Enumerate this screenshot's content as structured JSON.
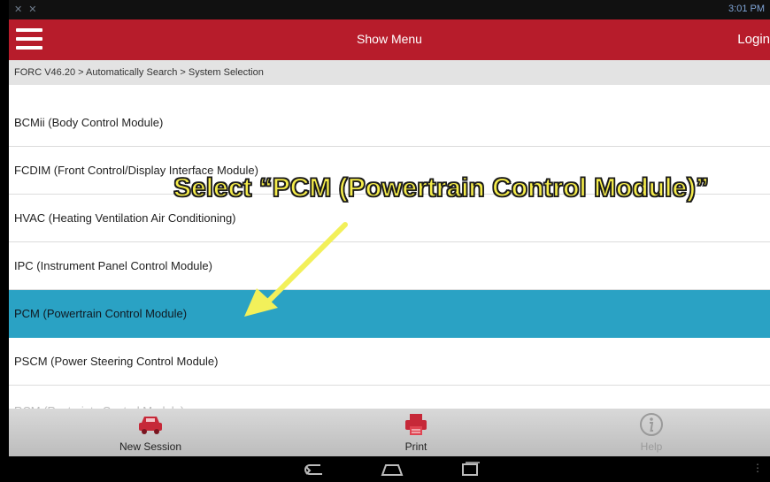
{
  "status_bar": {
    "left_icons": "✕ ✕",
    "time": "3:01 PM"
  },
  "header": {
    "title": "Show Menu",
    "login_label": "Login"
  },
  "breadcrumb": {
    "text": "FORC V46.20 > Automatically Search > System Selection"
  },
  "list": {
    "items": [
      {
        "label": "BCMii (Body Control Module)"
      },
      {
        "label": "FCDIM (Front Control/Display Interface Module)"
      },
      {
        "label": "HVAC (Heating Ventilation Air Conditioning)"
      },
      {
        "label": "IPC (Instrument Panel Control Module)"
      },
      {
        "label": "PCM (Powertrain Control Module)",
        "selected": true
      },
      {
        "label": "PSCM (Power Steering Control Module)"
      },
      {
        "label": "RCM (Restraints Control Module)"
      }
    ]
  },
  "annotation": {
    "text": "Select “PCM (Powertrain Control Module)”",
    "color": "#f5ec4a"
  },
  "toolbar": {
    "new_session_label": "New Session",
    "print_label": "Print",
    "help_label": "Help"
  },
  "colors": {
    "header": "#b71c2b",
    "selected_row": "#2aa2c4",
    "arrow": "#f2f05a"
  }
}
